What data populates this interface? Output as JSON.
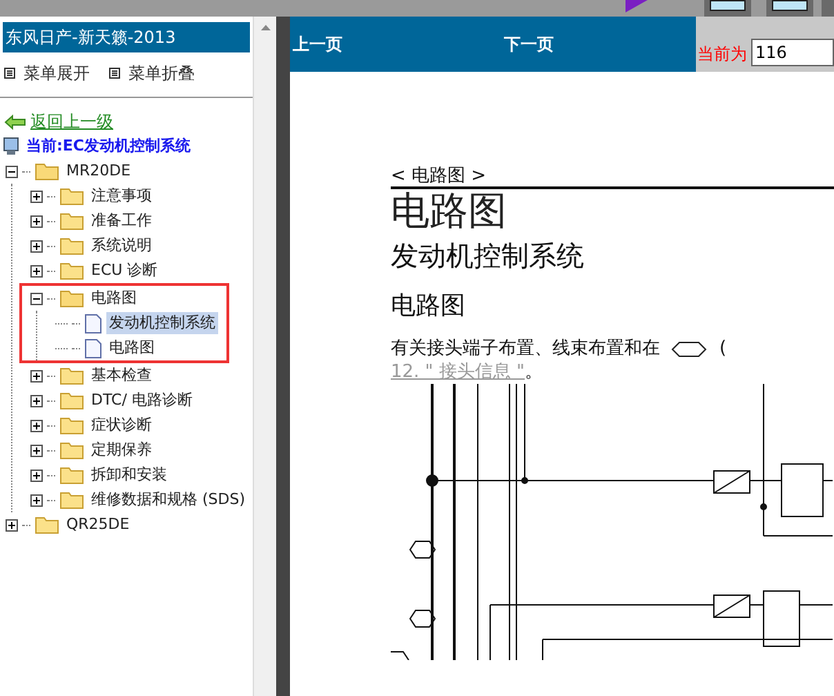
{
  "sidebar": {
    "title": "东风日产-新天籁-2013",
    "menu_buttons": [
      "菜单展开",
      "菜单折叠"
    ],
    "back_link": "返回上一级",
    "current": "当前:EC发动机控制系统",
    "tree": [
      {
        "label": "MR20DE",
        "kind": "folder",
        "expanded": true,
        "selected": false,
        "highlighted": false,
        "children": [
          {
            "label": "注意事项",
            "kind": "folder",
            "expanded": false,
            "selected": false,
            "highlighted": false
          },
          {
            "label": "准备工作",
            "kind": "folder",
            "expanded": false,
            "selected": false,
            "highlighted": false
          },
          {
            "label": "系统说明",
            "kind": "folder",
            "expanded": false,
            "selected": false,
            "highlighted": false
          },
          {
            "label": "ECU 诊断",
            "kind": "folder",
            "expanded": false,
            "selected": false,
            "highlighted": false
          },
          {
            "label": "电路图",
            "kind": "folder",
            "expanded": true,
            "selected": false,
            "highlighted": true,
            "children": [
              {
                "label": "发动机控制系统",
                "kind": "page",
                "selected": true,
                "highlighted": false
              },
              {
                "label": "电路图",
                "kind": "page",
                "selected": false,
                "highlighted": false
              }
            ]
          },
          {
            "label": "基本检查",
            "kind": "folder",
            "expanded": false,
            "selected": false,
            "highlighted": false
          },
          {
            "label": "DTC/ 电路诊断",
            "kind": "folder",
            "expanded": false,
            "selected": false,
            "highlighted": false
          },
          {
            "label": "症状诊断",
            "kind": "folder",
            "expanded": false,
            "selected": false,
            "highlighted": false
          },
          {
            "label": "定期保养",
            "kind": "folder",
            "expanded": false,
            "selected": false,
            "highlighted": false
          },
          {
            "label": "拆卸和安装",
            "kind": "folder",
            "expanded": false,
            "selected": false,
            "highlighted": false
          },
          {
            "label": "维修数据和规格 (SDS)",
            "kind": "folder",
            "expanded": false,
            "selected": false,
            "highlighted": false
          }
        ]
      },
      {
        "label": "QR25DE",
        "kind": "folder",
        "expanded": false,
        "selected": false,
        "highlighted": false
      }
    ]
  },
  "toolbar": {
    "prev": "上一页",
    "next": "下一页",
    "current_label": "当前为",
    "page_value": "116"
  },
  "document": {
    "breadcrumb": "< 电路图 >",
    "title": "电路图",
    "subtitle": "发动机控制系统",
    "section": "电路图",
    "text_line": "有关接头端子布置、线束布置和在",
    "text_paren": "(",
    "link": "12. \" 接头信息 \"",
    "link_after": "。"
  }
}
